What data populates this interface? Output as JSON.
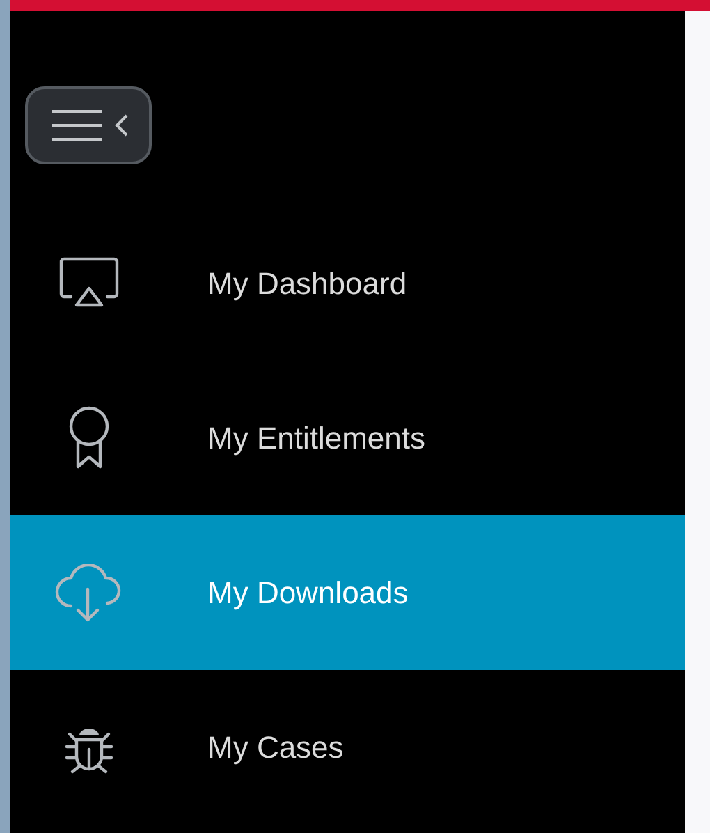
{
  "sidebar": {
    "items": [
      {
        "label": "My Dashboard",
        "selected": false
      },
      {
        "label": "My Entitlements",
        "selected": false
      },
      {
        "label": "My Downloads",
        "selected": true
      },
      {
        "label": "My Cases",
        "selected": false
      }
    ]
  }
}
